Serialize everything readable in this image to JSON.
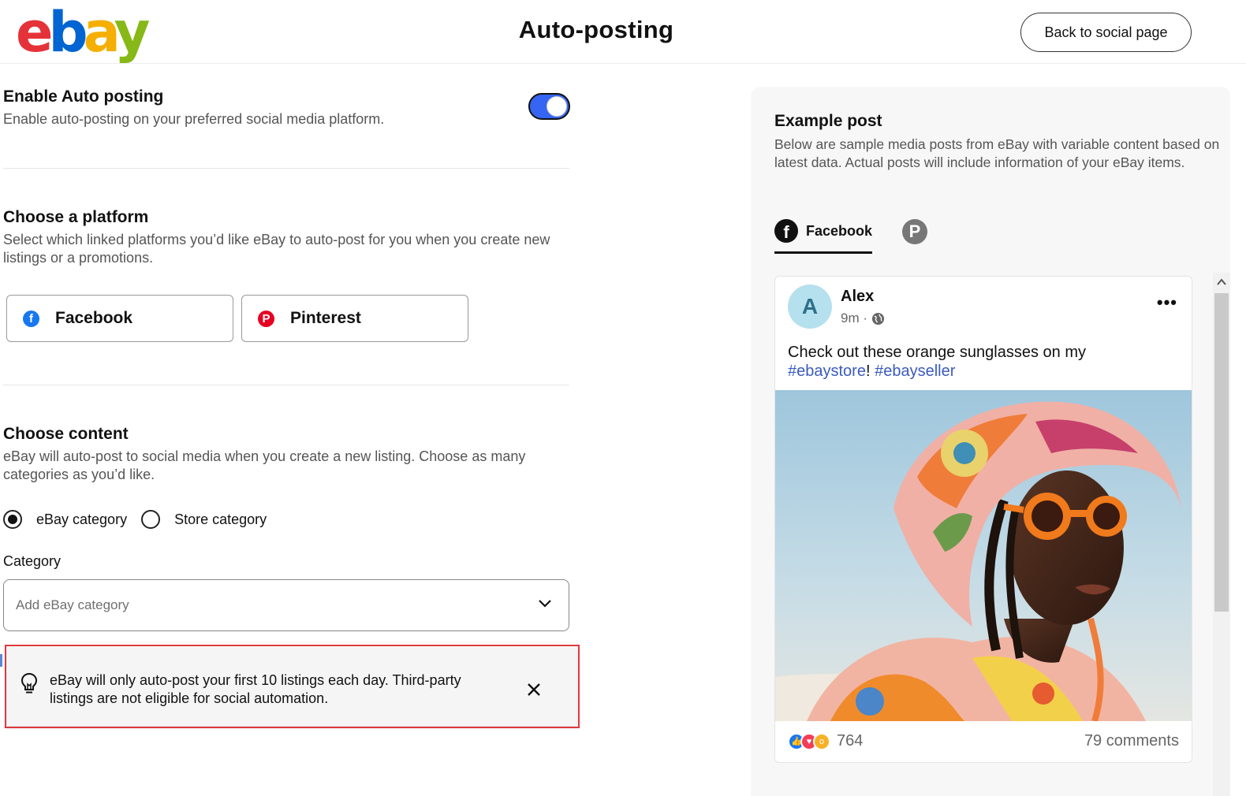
{
  "header": {
    "logo_letters": [
      "e",
      "b",
      "a",
      "y"
    ],
    "title": "Auto-posting",
    "back_button": "Back to social page"
  },
  "auto_posting": {
    "title": "Enable Auto posting",
    "description": "Enable auto-posting on your preferred social media platform.",
    "enabled": true
  },
  "platform": {
    "title": "Choose a platform",
    "description": "Select which linked platforms you’d like eBay to auto-post for you when you create new listings or a promotions.",
    "options": [
      {
        "label": "Facebook",
        "icon": "facebook-icon",
        "color": "#1877f2"
      },
      {
        "label": "Pinterest",
        "icon": "pinterest-icon",
        "color": "#e60023"
      }
    ]
  },
  "content": {
    "title": "Choose content",
    "description": "eBay will auto-post to social media when you create a new listing. Choose as many categories as you’d like.",
    "radio_options": [
      {
        "label": "eBay category",
        "checked": true
      },
      {
        "label": "Store category",
        "checked": false
      }
    ],
    "category_label": "Category",
    "category_placeholder": "Add eBay category"
  },
  "notice": {
    "text": "eBay will only auto-post your first 10 listings each day. Third-party listings are not eligible for social automation."
  },
  "example": {
    "title": "Example post",
    "description": "Below are sample media posts from eBay with variable content based on latest data. Actual posts will include information of your eBay items.",
    "tabs": [
      {
        "label": "Facebook",
        "active": true
      },
      {
        "label": "",
        "icon": "pinterest-icon",
        "active": false
      }
    ],
    "post": {
      "avatar_letter": "A",
      "author": "Alex",
      "time": "9m ·",
      "text": "Check out these orange sunglasses on my ",
      "hashtag1": "#ebaystore",
      "separator": "! ",
      "hashtag2": "#ebayseller",
      "reaction_count": "764",
      "comments": "79 comments"
    }
  },
  "colors": {
    "accent": "#3665f3",
    "highlight_border": "#e0383e",
    "hashtag": "#3b5bbd"
  }
}
